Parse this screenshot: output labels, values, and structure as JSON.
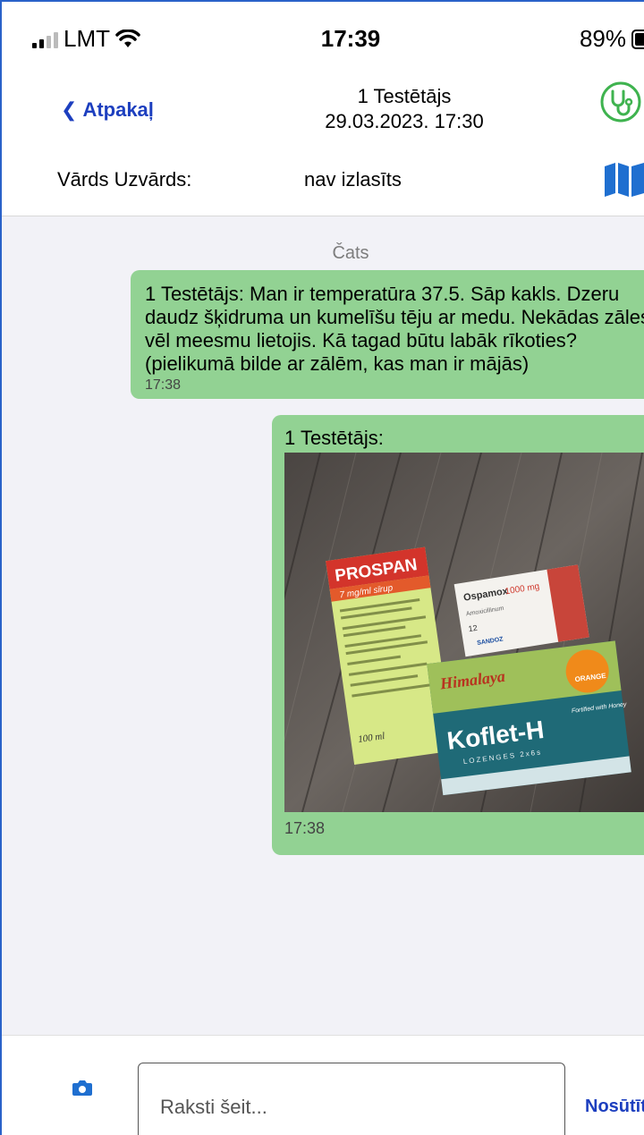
{
  "status_bar": {
    "carrier": "LMT",
    "time": "17:39",
    "battery": "89%",
    "battery_level": 0.89
  },
  "header": {
    "back_label": "Atpakaļ",
    "title": "1 Testētājs",
    "datetime": "29.03.2023. 17:30",
    "name_label": "Vārds Uzvārds:",
    "name_value": "nav izlasīts"
  },
  "chat": {
    "title": "Čats",
    "messages": [
      {
        "text": "1 Testētājs: Man ir temperatūra 37.5. Sāp kakls. Dzeru daudz šķidruma un kumelīšu tēju ar medu. Nekādas zāles vēl meesmu lietojis. Kā tagad būtu labāk rīkoties? (pielikumā bilde ar zālēm, kas man ir mājās)",
        "time": "17:38"
      },
      {
        "sender": "1 Testētājs:",
        "time": "17:38"
      }
    ]
  },
  "photo_labels": {
    "prospan_brand": "PROSPAN",
    "prospan_sub": "7 mg/ml sīrup",
    "prospan_volume": "100 ml",
    "ospamox_brand": "Ospamox",
    "ospamox_dose": "1000 mg",
    "ospamox_generic": "Amoxicillinum",
    "ospamox_maker": "SANDOZ",
    "himalaya_brand": "Himalaya",
    "koflet_name": "Koflet-H",
    "koflet_sub": "LOZENGES 2x6s",
    "koflet_flavour": "ORANGE",
    "koflet_honey": "Fortified with Honey"
  },
  "input": {
    "placeholder": "Raksti šeit...",
    "send_label": "Nosūtīt"
  },
  "colors": {
    "accent_blue": "#1d3fbf",
    "bubble_green": "#92d293",
    "icon_green": "#3fb34f"
  }
}
